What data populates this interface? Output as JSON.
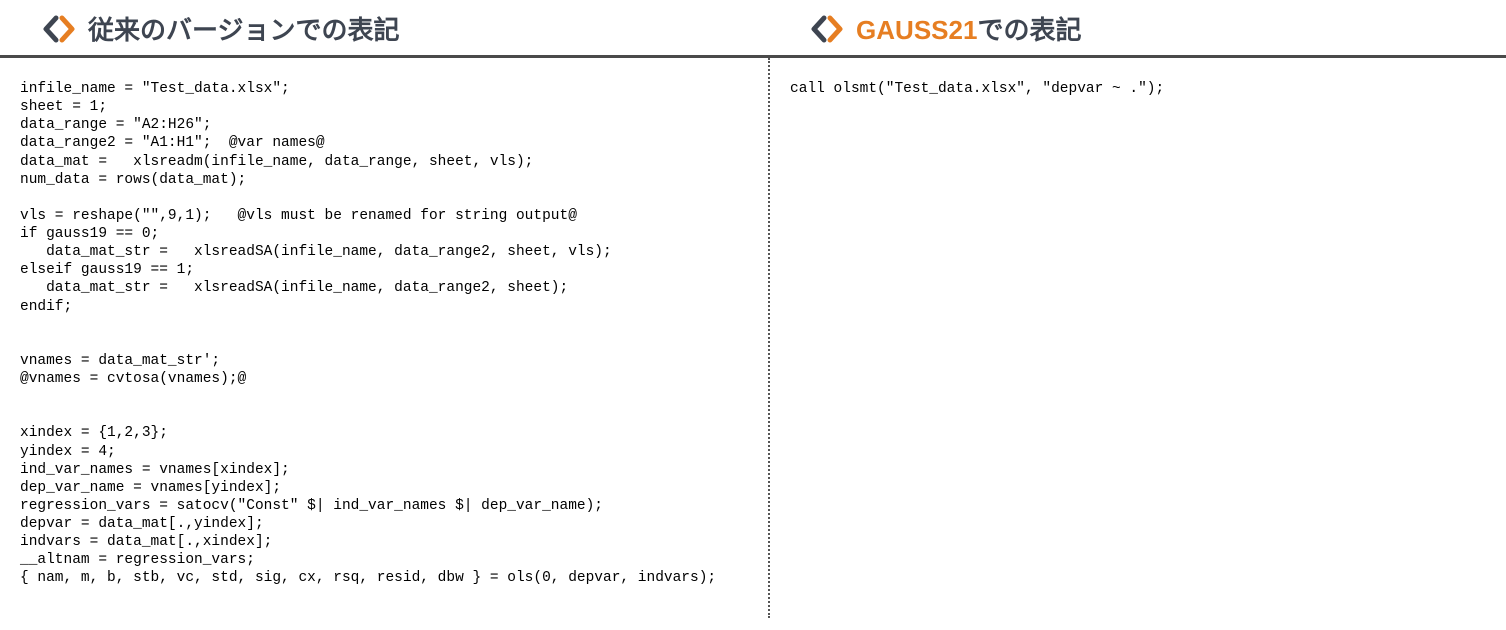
{
  "left": {
    "title": "従来のバージョンでの表記",
    "code": "infile_name = \"Test_data.xlsx\";\nsheet = 1;\ndata_range = \"A2:H26\";\ndata_range2 = \"A1:H1\";  @var names@\ndata_mat =   xlsreadm(infile_name, data_range, sheet, vls);\nnum_data = rows(data_mat);\n\nvls = reshape(\"\",9,1);   @vls must be renamed for string output@\nif gauss19 == 0;\n   data_mat_str =   xlsreadSA(infile_name, data_range2, sheet, vls);\nelseif gauss19 == 1;\n   data_mat_str =   xlsreadSA(infile_name, data_range2, sheet);\nendif;\n\n\nvnames = data_mat_str';\n@vnames = cvtosa(vnames);@\n\n\nxindex = {1,2,3};\nyindex = 4;\nind_var_names = vnames[xindex];\ndep_var_name = vnames[yindex];\nregression_vars = satocv(\"Const\" $| ind_var_names $| dep_var_name);\ndepvar = data_mat[.,yindex];\nindvars = data_mat[.,xindex];\n__altnam = regression_vars;\n{ nam, m, b, stb, vc, std, sig, cx, rsq, resid, dbw } = ols(0, depvar, indvars);"
  },
  "right": {
    "title_prefix": "GAUSS21",
    "title_suffix": "での表記",
    "code": "call olsmt(\"Test_data.xlsx\", \"depvar ~ .\");"
  },
  "colors": {
    "accent": "#e67e22",
    "header_text": "#3e4551",
    "rule": "#4a4a4a"
  }
}
